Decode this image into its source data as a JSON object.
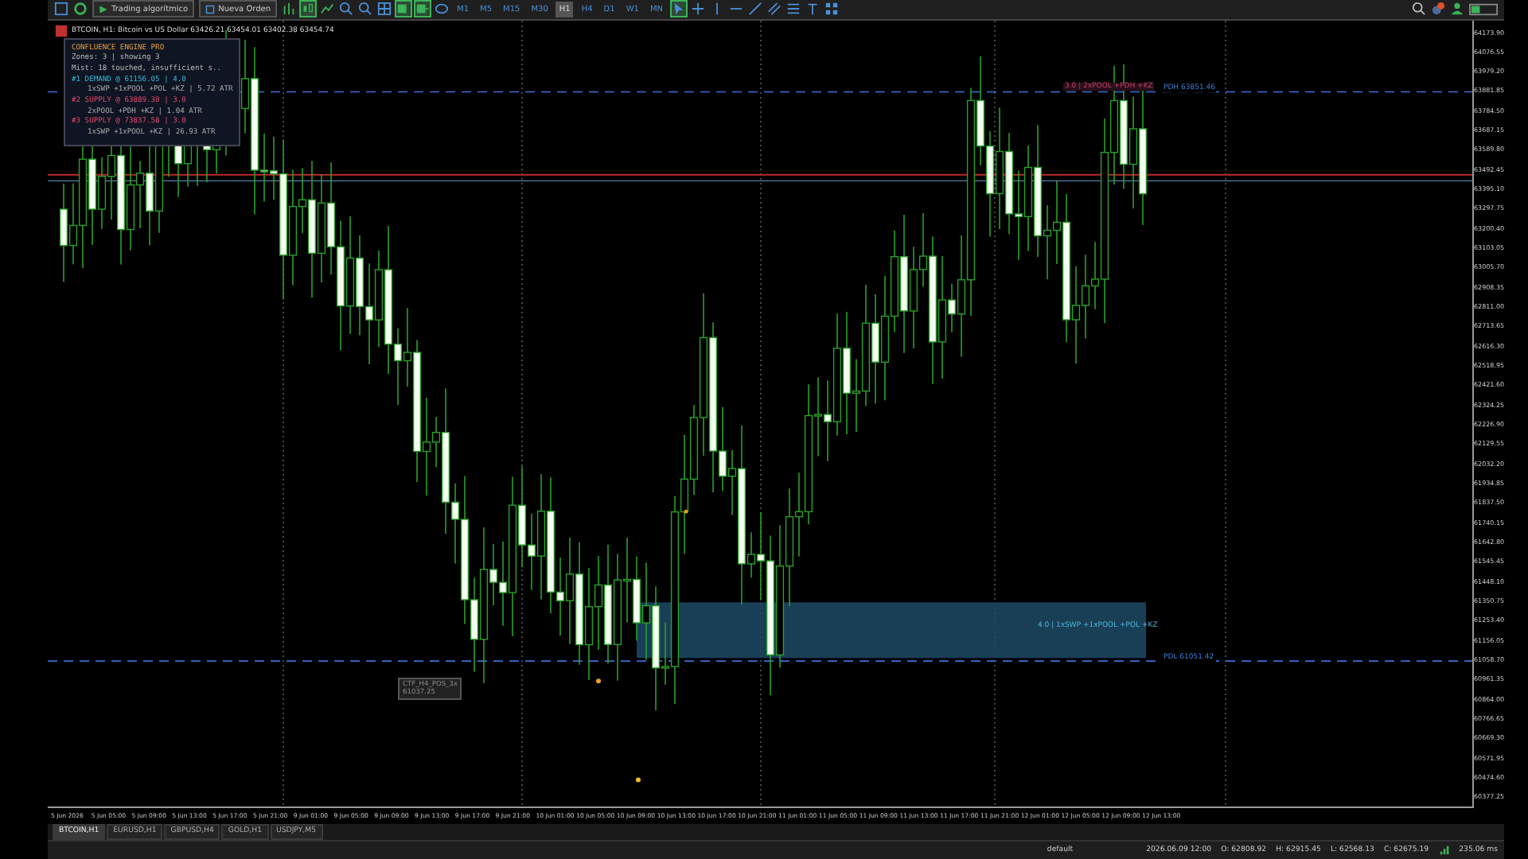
{
  "toolbar": {
    "algo_button": "Trading algorítmico",
    "order_button": "Nueva Orden",
    "timeframes": [
      {
        "label": "M1",
        "selected": false
      },
      {
        "label": "M5",
        "selected": false
      },
      {
        "label": "M15",
        "selected": false
      },
      {
        "label": "M30",
        "selected": false
      },
      {
        "label": "H1",
        "selected": true
      },
      {
        "label": "H4",
        "selected": false
      },
      {
        "label": "D1",
        "selected": false
      },
      {
        "label": "W1",
        "selected": false
      },
      {
        "label": "MN",
        "selected": false
      }
    ]
  },
  "chart": {
    "title": "BTCOIN, H1: Bitcoin vs US Dollar 63426.21 63454.01 63402.38 63454.74",
    "panel": {
      "title": "CONFLUENCE ENGINE PRO",
      "lines": [
        {
          "kind": "info",
          "text": "Zones: 3 | showing 3"
        },
        {
          "kind": "info",
          "text": "Mist: 18 touched, insufficient s.."
        },
        {
          "kind": "demand",
          "text": "#1 DEMAND @ 61156.05 | 4.0"
        },
        {
          "kind": "detail",
          "text": "1xSWP +1xPOOL +POL +KZ | 5.72 ATR"
        },
        {
          "kind": "supply",
          "text": "#2 SUPPLY @ 63889.30 | 3.0"
        },
        {
          "kind": "detail",
          "text": "2xPOOL +PDH +KZ | 1.04 ATR"
        },
        {
          "kind": "supply",
          "text": "#3 SUPPLY @ 73837.58 | 3.0"
        },
        {
          "kind": "detail",
          "text": "1xSWP +1xPOOL +KZ | 26.93 ATR"
        }
      ]
    },
    "levels": [
      {
        "kind": "high",
        "label": "PDH 63851.46"
      },
      {
        "kind": "low",
        "label": "PDL 61051.42"
      }
    ],
    "supply_label": "3.0 | 2xPOOL +PDH +KZ",
    "zone_label": "4.0 | 1xSWP +1xPOOL +POL +KZ",
    "marker_label": [
      "CTF_H4_POS_3x",
      "61037.25"
    ],
    "price_axis": [
      "64173.90",
      "64076.55",
      "63979.20",
      "63881.85",
      "63784.50",
      "63687.15",
      "63589.80",
      "63492.45",
      "63395.10",
      "63297.75",
      "63200.40",
      "63103.05",
      "63005.70",
      "62908.35",
      "62811.00",
      "62713.65",
      "62616.30",
      "62518.95",
      "62421.60",
      "62324.25",
      "62226.90",
      "62129.55",
      "62032.20",
      "61934.85",
      "61837.50",
      "61740.15",
      "61642.80",
      "61545.45",
      "61448.10",
      "61350.75",
      "61253.40",
      "61156.05",
      "61058.70",
      "60961.35",
      "60864.00",
      "60766.65",
      "60669.30",
      "60571.95",
      "60474.60",
      "60377.25"
    ],
    "time_axis": [
      "5 Jun 2026",
      "5 Jun 05:00",
      "5 Jun 09:00",
      "5 Jun 13:00",
      "5 Jun 17:00",
      "5 Jun 21:00",
      "9 Jun 01:00",
      "9 Jun 05:00",
      "9 Jun 09:00",
      "9 Jun 13:00",
      "9 Jun 17:00",
      "9 Jun 21:00",
      "10 Jun 01:00",
      "10 Jun 05:00",
      "10 Jun 09:00",
      "10 Jun 13:00",
      "10 Jun 17:00",
      "10 Jun 21:00",
      "11 Jun 01:00",
      "11 Jun 05:00",
      "11 Jun 09:00",
      "11 Jun 13:00",
      "11 Jun 17:00",
      "11 Jun 21:00",
      "12 Jun 01:00",
      "12 Jun 05:00",
      "12 Jun 09:00",
      "12 Jun 13:00"
    ]
  },
  "tabs": [
    {
      "label": "BTCOIN,H1",
      "selected": true
    },
    {
      "label": "EURUSD,H1",
      "selected": false
    },
    {
      "label": "GBPUSD,H4",
      "selected": false
    },
    {
      "label": "GOLD,H1",
      "selected": false
    },
    {
      "label": "USDJPY,M5",
      "selected": false
    }
  ],
  "status_bar": {
    "profile": "default",
    "time": "2026.06.09 12:00",
    "open": "O: 62808.92",
    "high": "H: 62915.45",
    "low": "L: 62568.13",
    "close": "C: 62675.19",
    "ping": "235.06 ms"
  }
}
